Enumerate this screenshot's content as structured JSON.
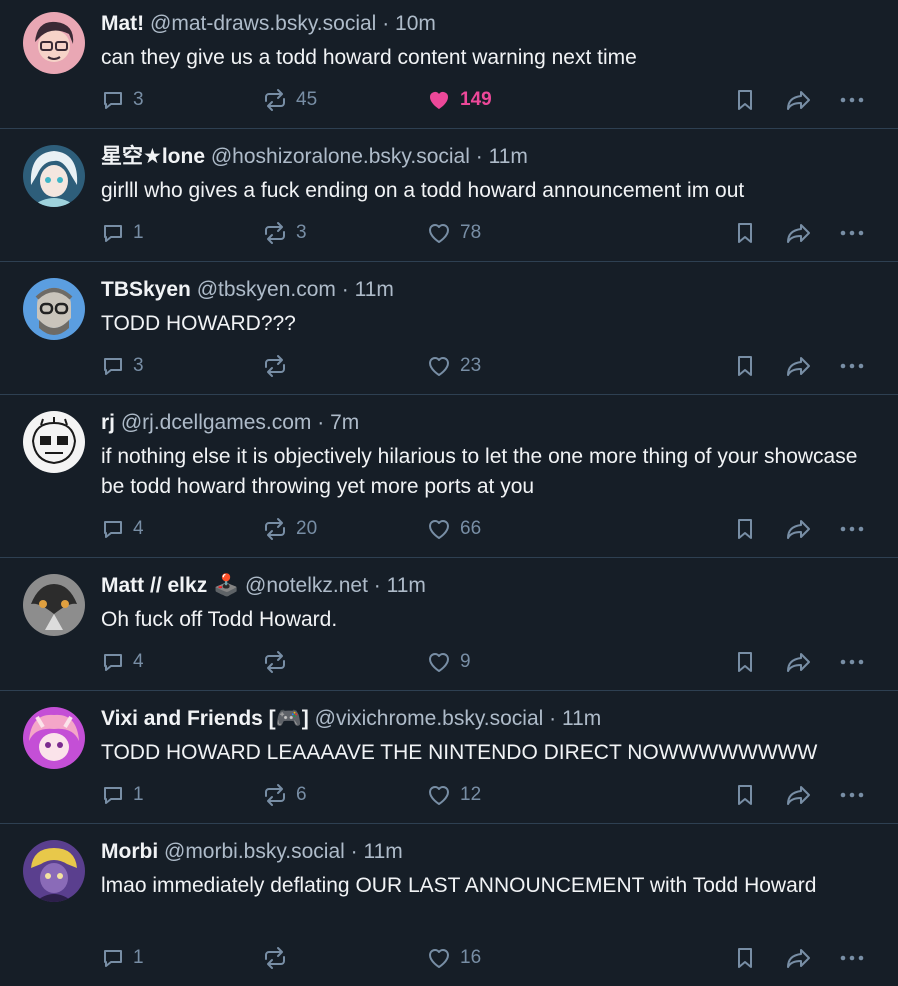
{
  "posts": [
    {
      "name": "Mat!",
      "handle": "@mat-draws.bsky.social",
      "separator": "·",
      "time": "10m",
      "text": "can they give us a todd howard content warning next time",
      "replies": "3",
      "reposts": "45",
      "likes": "149",
      "liked": true,
      "avatar": {
        "bg": "#e9a7b4",
        "accent": "#3a2a35"
      }
    },
    {
      "name": "星空★lone",
      "handle": "@hoshizoralone.bsky.social",
      "separator": "·",
      "time": "11m",
      "text": "girlll who gives a fuck ending on a todd howard announcement im out",
      "replies": "1",
      "reposts": "3",
      "likes": "78",
      "liked": false,
      "avatar": {
        "bg": "#9fd2dc",
        "accent": "#e8f0f4"
      }
    },
    {
      "name": "TBSkyen",
      "handle": "@tbskyen.com",
      "separator": "·",
      "time": "11m",
      "text": "TODD HOWARD???",
      "replies": "3",
      "reposts": "",
      "likes": "23",
      "liked": false,
      "avatar": {
        "bg": "#5b9ee0",
        "accent": "#6e6b66"
      }
    },
    {
      "name": "rj",
      "handle": "@rj.dcellgames.com",
      "separator": "·",
      "time": "7m",
      "text": "if nothing else it is objectively hilarious to let the one more thing of your showcase be todd howard throwing yet more ports at you",
      "replies": "4",
      "reposts": "20",
      "likes": "66",
      "liked": false,
      "avatar": {
        "bg": "#f4f4f4",
        "accent": "#1a1a1a"
      }
    },
    {
      "name": "Matt // elkz 🕹️",
      "handle": "@notelkz.net",
      "separator": "·",
      "time": "11m",
      "text": "Oh fuck off Todd Howard.",
      "replies": "4",
      "reposts": "",
      "likes": "9",
      "liked": false,
      "avatar": {
        "bg": "#8d8d8d",
        "accent": "#e0a040"
      }
    },
    {
      "name": "Vixi and Friends [🎮]",
      "handle": "@vixichrome.bsky.social",
      "separator": "·",
      "time": "11m",
      "text": "TODD HOWARD LEAAAAVE THE NINTENDO DIRECT NOWWWWWWWW",
      "replies": "1",
      "reposts": "6",
      "likes": "12",
      "liked": false,
      "avatar": {
        "bg": "#c44fd6",
        "accent": "#f4a6c8"
      }
    },
    {
      "name": "Morbi",
      "handle": "@morbi.bsky.social",
      "separator": "·",
      "time": "11m",
      "text": "lmao immediately deflating OUR LAST ANNOUNCEMENT with Todd Howard",
      "replies": "1",
      "reposts": "",
      "likes": "16",
      "liked": false,
      "avatar": {
        "bg": "#5a3f8e",
        "accent": "#e8c84a"
      }
    }
  ],
  "colors": {
    "background": "#161e27",
    "divider": "#2e4052",
    "muted": "#788ea5",
    "like": "#ec4899"
  }
}
